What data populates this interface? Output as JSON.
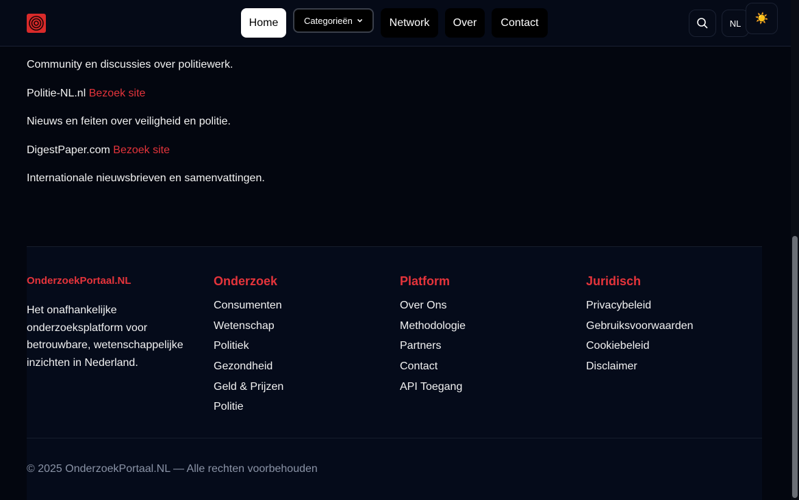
{
  "header": {
    "logo_icon": "target-logo-icon",
    "nav": {
      "home": "Home",
      "categories": "Categorieën",
      "network": "Network",
      "about": "Over",
      "contact": "Contact"
    },
    "search_icon": "search-icon",
    "language": "NL",
    "theme_icon": "sun-icon"
  },
  "content": {
    "items": [
      {
        "text": "Community en discussies over politiewerk."
      },
      {
        "site": "Politie-NL.nl",
        "link": "Bezoek site"
      },
      {
        "text": "Nieuws en feiten over veiligheid en politie."
      },
      {
        "site": "DigestPaper.com",
        "link": "Bezoek site"
      },
      {
        "text": "Internationale nieuwsbrieven en samenvattingen."
      }
    ]
  },
  "footer": {
    "brand": {
      "title": "OnderzoekPortaal.NL",
      "description": "Het onafhankelijke onderzoeksplatform voor betrouwbare, wetenschappelijke inzichten in Nederland."
    },
    "columns": [
      {
        "title": "Onderzoek",
        "links": [
          "Consumenten",
          "Wetenschap",
          "Politiek",
          "Gezondheid",
          "Geld & Prijzen",
          "Politie"
        ]
      },
      {
        "title": "Platform",
        "links": [
          "Over Ons",
          "Methodologie",
          "Partners",
          "Contact",
          "API Toegang"
        ]
      },
      {
        "title": "Juridisch",
        "links": [
          "Privacybeleid",
          "Gebruiksvoorwaarden",
          "Cookiebeleid",
          "Disclaimer"
        ]
      }
    ],
    "copyright": "© 2025 OnderzoekPortaal.NL — Alle rechten voorbehouden"
  },
  "colors": {
    "accent": "#e5343b",
    "background": "#03060f",
    "footer_bg": "#050b1a"
  }
}
